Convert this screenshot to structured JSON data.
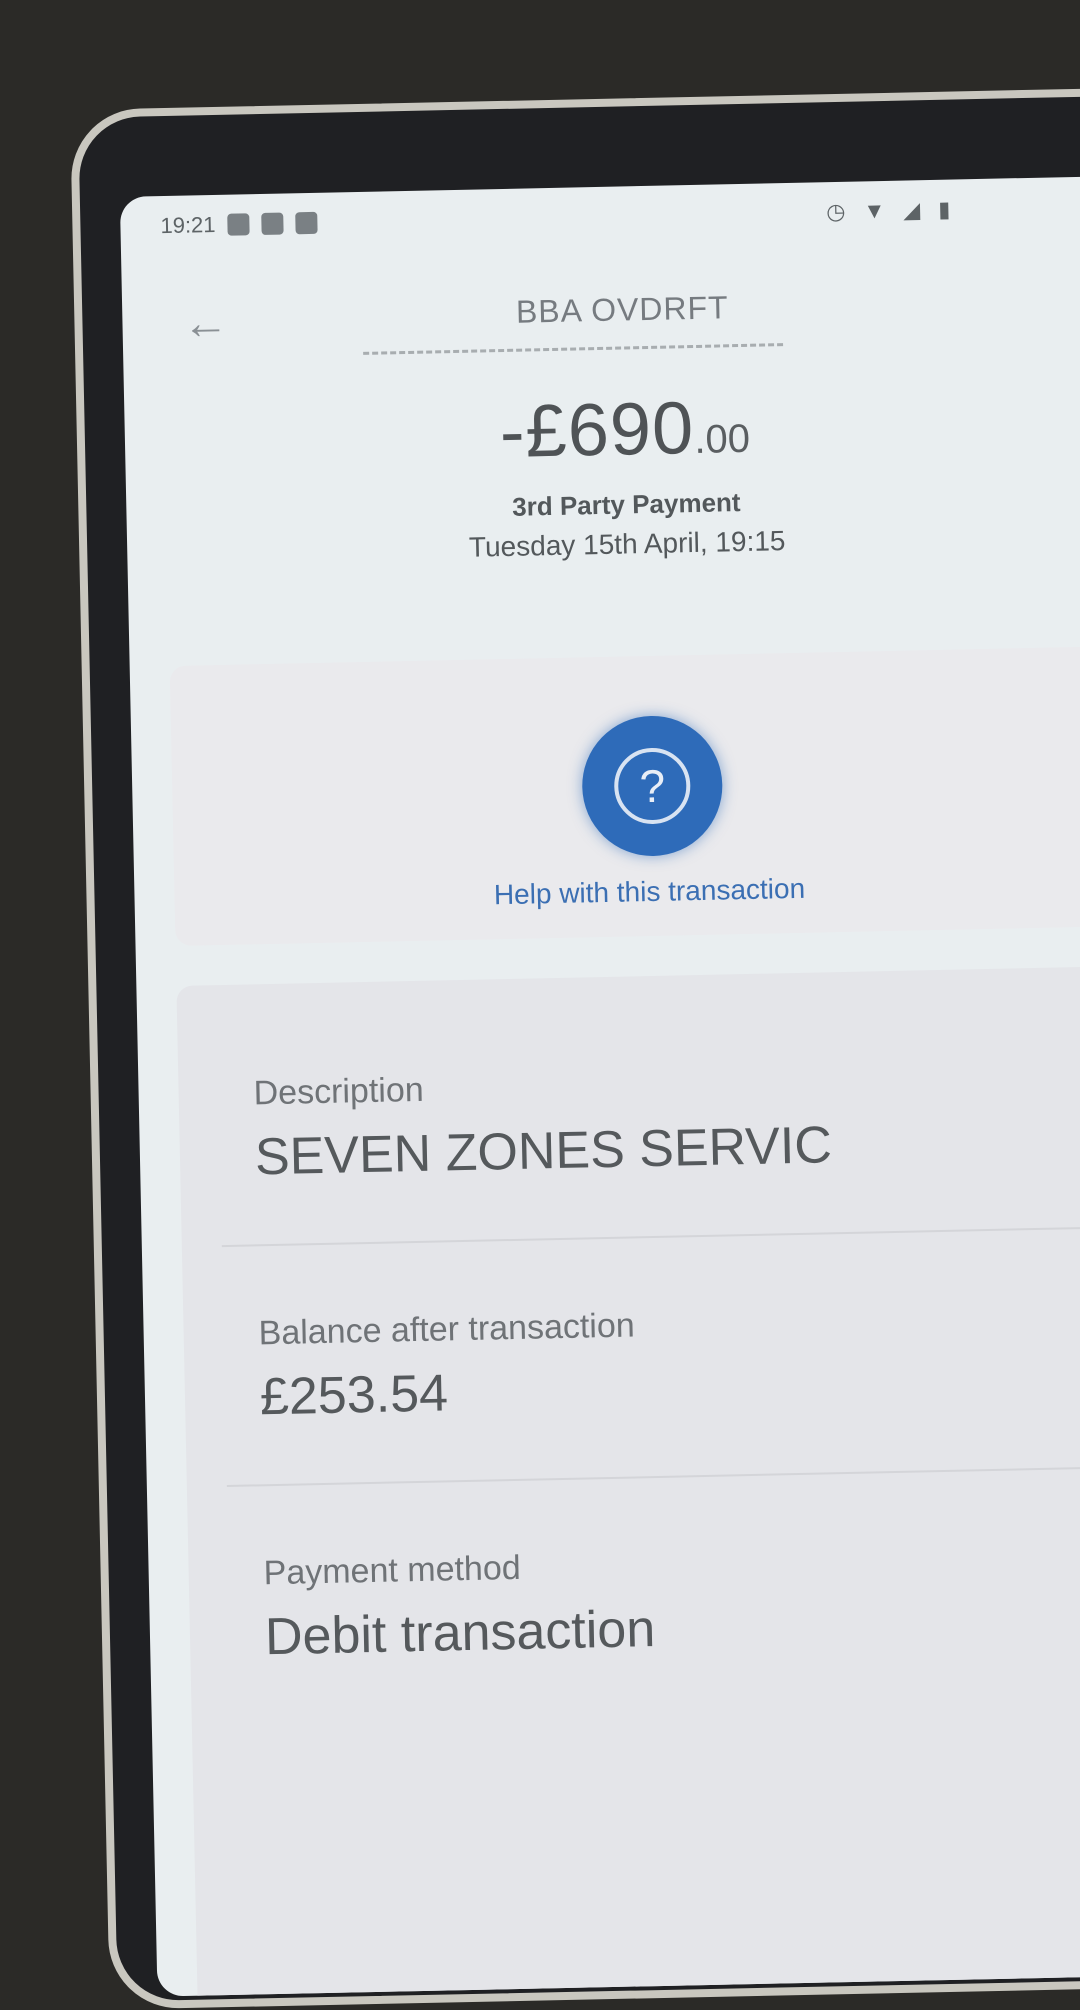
{
  "status_bar": {
    "time": "19:21"
  },
  "header": {
    "title": "BBA OVDRFT"
  },
  "transaction": {
    "amount_main": "-£690",
    "amount_pence": ".00",
    "type": "3rd Party Payment",
    "date": "Tuesday 15th April, 19:15"
  },
  "help": {
    "icon": "question-mark-icon",
    "label": "Help with this transaction"
  },
  "details": {
    "description_label": "Description",
    "description_value": "SEVEN ZONES SERVIC",
    "balance_label": "Balance after transaction",
    "balance_value": "£253.54",
    "payment_method_label": "Payment method",
    "payment_method_value": "Debit transaction"
  },
  "colors": {
    "accent": "#2e6bb9",
    "screen_background": "#e9eef0",
    "text": "#55595c"
  }
}
